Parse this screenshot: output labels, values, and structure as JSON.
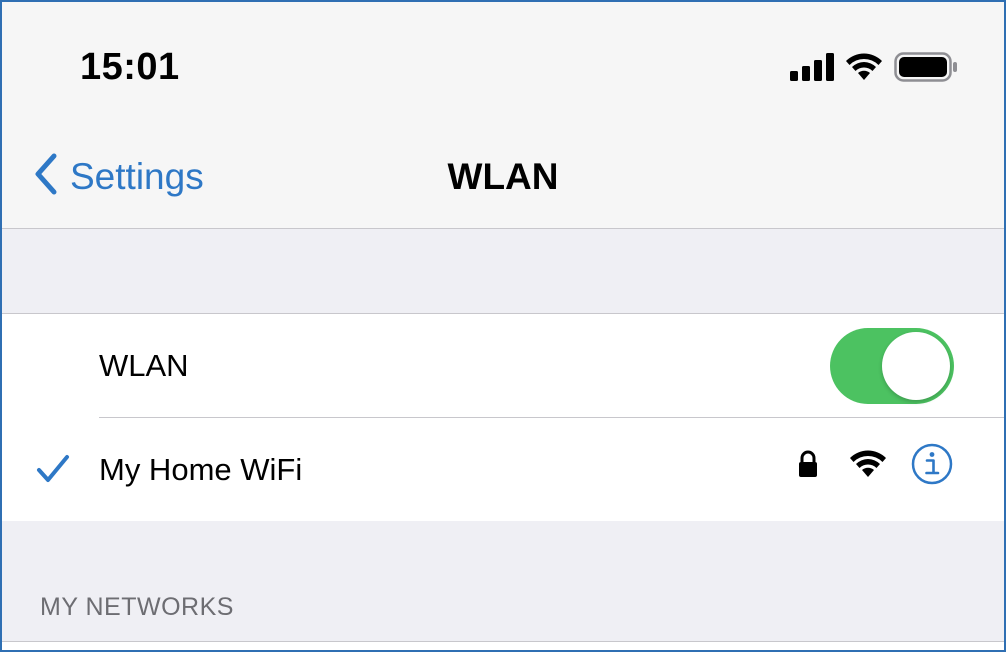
{
  "status_bar": {
    "time": "15:01",
    "icons": [
      "signal-icon",
      "wifi-icon",
      "battery-icon"
    ]
  },
  "nav": {
    "back_label": "Settings",
    "title": "WLAN"
  },
  "wlan_toggle": {
    "label": "WLAN",
    "on": true
  },
  "connected_network": {
    "name": "My Home WiFi",
    "icons": [
      "checkmark-icon",
      "lock-icon",
      "wifi-icon",
      "info-icon"
    ]
  },
  "section": {
    "header": "MY NETWORKS"
  },
  "colors": {
    "accent": "#2e78c6",
    "toggle_on": "#4cc261",
    "group_bg": "#efeff4",
    "header_text": "#6d6d72"
  }
}
